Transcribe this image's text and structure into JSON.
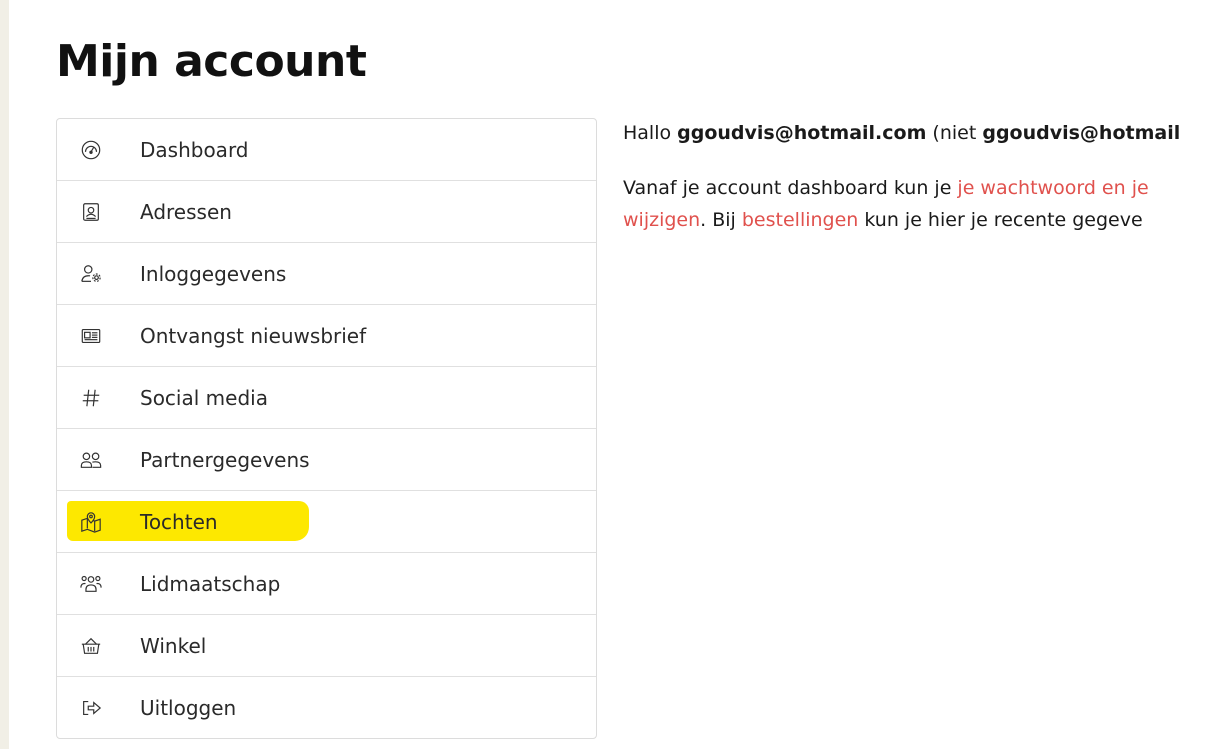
{
  "page": {
    "title": "Mijn account"
  },
  "colors": {
    "link": "#e0514d",
    "highlight": "#fde800",
    "border": "#dcdcdc"
  },
  "nav": {
    "items": [
      {
        "label": "Dashboard",
        "icon": "dashboard-gauge-icon"
      },
      {
        "label": "Adressen",
        "icon": "address-book-icon"
      },
      {
        "label": "Inloggegevens",
        "icon": "user-settings-icon"
      },
      {
        "label": "Ontvangst nieuwsbrief",
        "icon": "newspaper-icon"
      },
      {
        "label": "Social media",
        "icon": "hashtag-icon"
      },
      {
        "label": "Partnergegevens",
        "icon": "partners-icon"
      },
      {
        "label": "Tochten",
        "icon": "map-pin-icon",
        "highlighted": true
      },
      {
        "label": "Lidmaatschap",
        "icon": "group-icon"
      },
      {
        "label": "Winkel",
        "icon": "basket-icon"
      },
      {
        "label": "Uitloggen",
        "icon": "logout-icon"
      }
    ]
  },
  "content": {
    "greeting": {
      "prefix": "Hallo ",
      "email": "ggoudvis@hotmail.com",
      "mid": " (niet ",
      "email2": "ggoudvis@hotmail"
    },
    "intro": {
      "line1_text": "Vanaf je account dashboard kun je ",
      "line1_link": "je wachtwoord en je",
      "line2_link1": "wijzigen",
      "line2_text1": ". Bij ",
      "line2_link2": "bestellingen",
      "line2_text2": " kun je hier je recente gegeve"
    }
  }
}
